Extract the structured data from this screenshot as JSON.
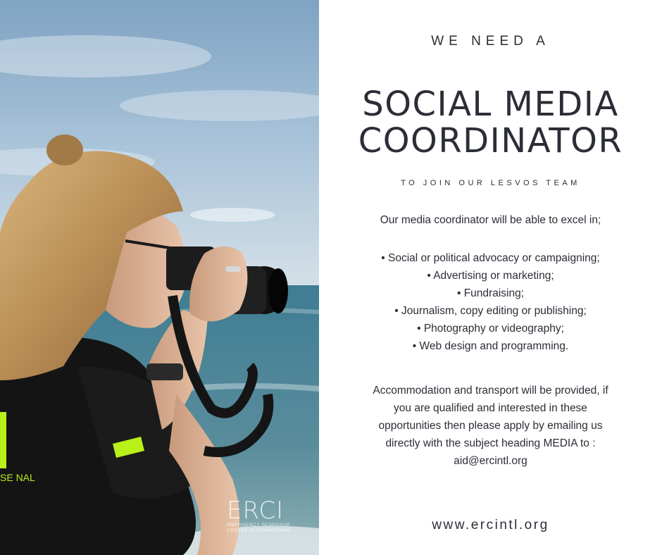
{
  "photo": {
    "alt": "Woman photographing the sea with a camera",
    "shirt_text_1": "ERCI",
    "shirt_text_2": "SE NAL",
    "colors": {
      "sky": "#a9c3d9",
      "sea": "#4b7f93",
      "shirt": "#141414",
      "hair": "#c29a63",
      "accent": "#b8f01a"
    }
  },
  "logo": {
    "mark": "ERCI",
    "subline_1": "Emergency Response",
    "subline_2": "Centre International"
  },
  "content": {
    "kicker": "WE NEED A",
    "title_line_1": "SOCIAL MEDIA",
    "title_line_2": "COORDINATOR",
    "subtitle": "TO JOIN OUR LESVOS TEAM",
    "intro": "Our media coordinator will be able to excel in;",
    "skills": [
      "• Social or political advocacy or campaigning;",
      "• Advertising or marketing;",
      "• Fundraising;",
      "• Journalism, copy editing or publishing;",
      "• Photography or videography;",
      "• Web design and programming."
    ],
    "paragraph_lines": [
      "Accommodation and transport will be provided, if",
      "you are qualified and interested in these",
      "opportunities then please apply by emailing us",
      "directly with the subject heading MEDIA to :",
      "aid@ercintl.org"
    ],
    "website": "www.ercintl.org"
  }
}
